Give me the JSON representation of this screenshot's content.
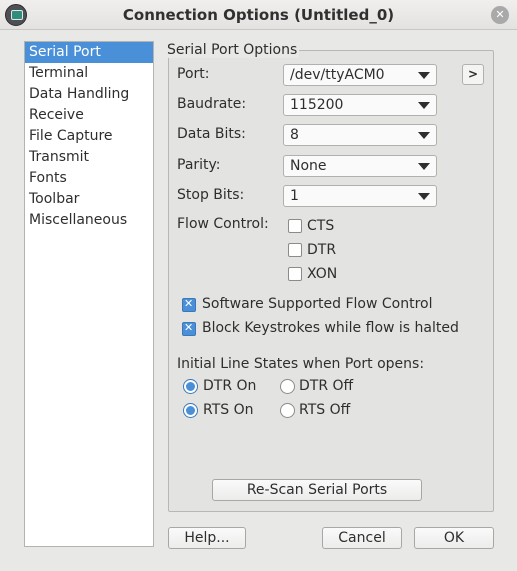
{
  "window": {
    "title": "Connection Options (Untitled_0)"
  },
  "nav": {
    "items": [
      {
        "label": "Serial Port",
        "selected": true
      },
      {
        "label": "Terminal"
      },
      {
        "label": "Data Handling"
      },
      {
        "label": "Receive"
      },
      {
        "label": "File Capture"
      },
      {
        "label": "Transmit"
      },
      {
        "label": "Fonts"
      },
      {
        "label": "Toolbar"
      },
      {
        "label": "Miscellaneous"
      }
    ]
  },
  "serial": {
    "group_title": "Serial Port Options",
    "port": {
      "label": "Port:",
      "value": "/dev/ttyACM0"
    },
    "expand_label": ">",
    "baudrate": {
      "label": "Baudrate:",
      "value": "115200"
    },
    "databits": {
      "label": "Data Bits:",
      "value": "8"
    },
    "parity": {
      "label": "Parity:",
      "value": "None"
    },
    "stopbits": {
      "label": "Stop Bits:",
      "value": "1"
    },
    "flow": {
      "label": "Flow Control:",
      "cts": {
        "label": "CTS",
        "checked": false
      },
      "dtr": {
        "label": "DTR",
        "checked": false
      },
      "xon": {
        "label": "XON",
        "checked": false
      }
    },
    "software_flow": {
      "label": "Software Supported Flow Control",
      "checked": true
    },
    "block_keystrokes": {
      "label": "Block Keystrokes while flow is halted",
      "checked": true
    },
    "line_states": {
      "label": "Initial Line States when Port opens:",
      "dtr_on": "DTR On",
      "dtr_off": "DTR Off",
      "rts_on": "RTS On",
      "rts_off": "RTS Off",
      "dtr_selected": "on",
      "rts_selected": "on"
    },
    "rescan_label": "Re-Scan Serial Ports"
  },
  "footer": {
    "help": "Help...",
    "cancel": "Cancel",
    "ok": "OK"
  }
}
